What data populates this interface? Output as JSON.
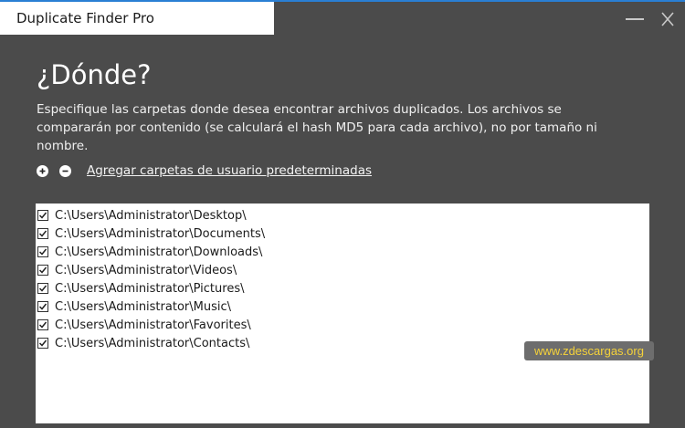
{
  "window": {
    "title": "Duplicate Finder Pro",
    "close_glyph": "X",
    "accent_color": "#2a7fd4"
  },
  "page": {
    "heading": "¿Dónde?",
    "description": "Especifique las carpetas donde desea encontrar archivos duplicados. Los archivos se compararán por contenido (se calculará el hash MD5 para cada archivo), no por tamaño ni nombre."
  },
  "toolbar": {
    "add_icon": "plus-circle-icon",
    "remove_icon": "minus-circle-icon",
    "default_folders_link": "Agregar carpetas de usuario predeterminadas"
  },
  "folders": [
    {
      "path": "C:\\Users\\Administrator\\Desktop\\",
      "checked": true
    },
    {
      "path": "C:\\Users\\Administrator\\Documents\\",
      "checked": true
    },
    {
      "path": "C:\\Users\\Administrator\\Downloads\\",
      "checked": true
    },
    {
      "path": "C:\\Users\\Administrator\\Videos\\",
      "checked": true
    },
    {
      "path": "C:\\Users\\Administrator\\Pictures\\",
      "checked": true
    },
    {
      "path": "C:\\Users\\Administrator\\Music\\",
      "checked": true
    },
    {
      "path": "C:\\Users\\Administrator\\Favorites\\",
      "checked": true
    },
    {
      "path": "C:\\Users\\Administrator\\Contacts\\",
      "checked": true
    }
  ],
  "watermark": "www.zdescargas.org"
}
